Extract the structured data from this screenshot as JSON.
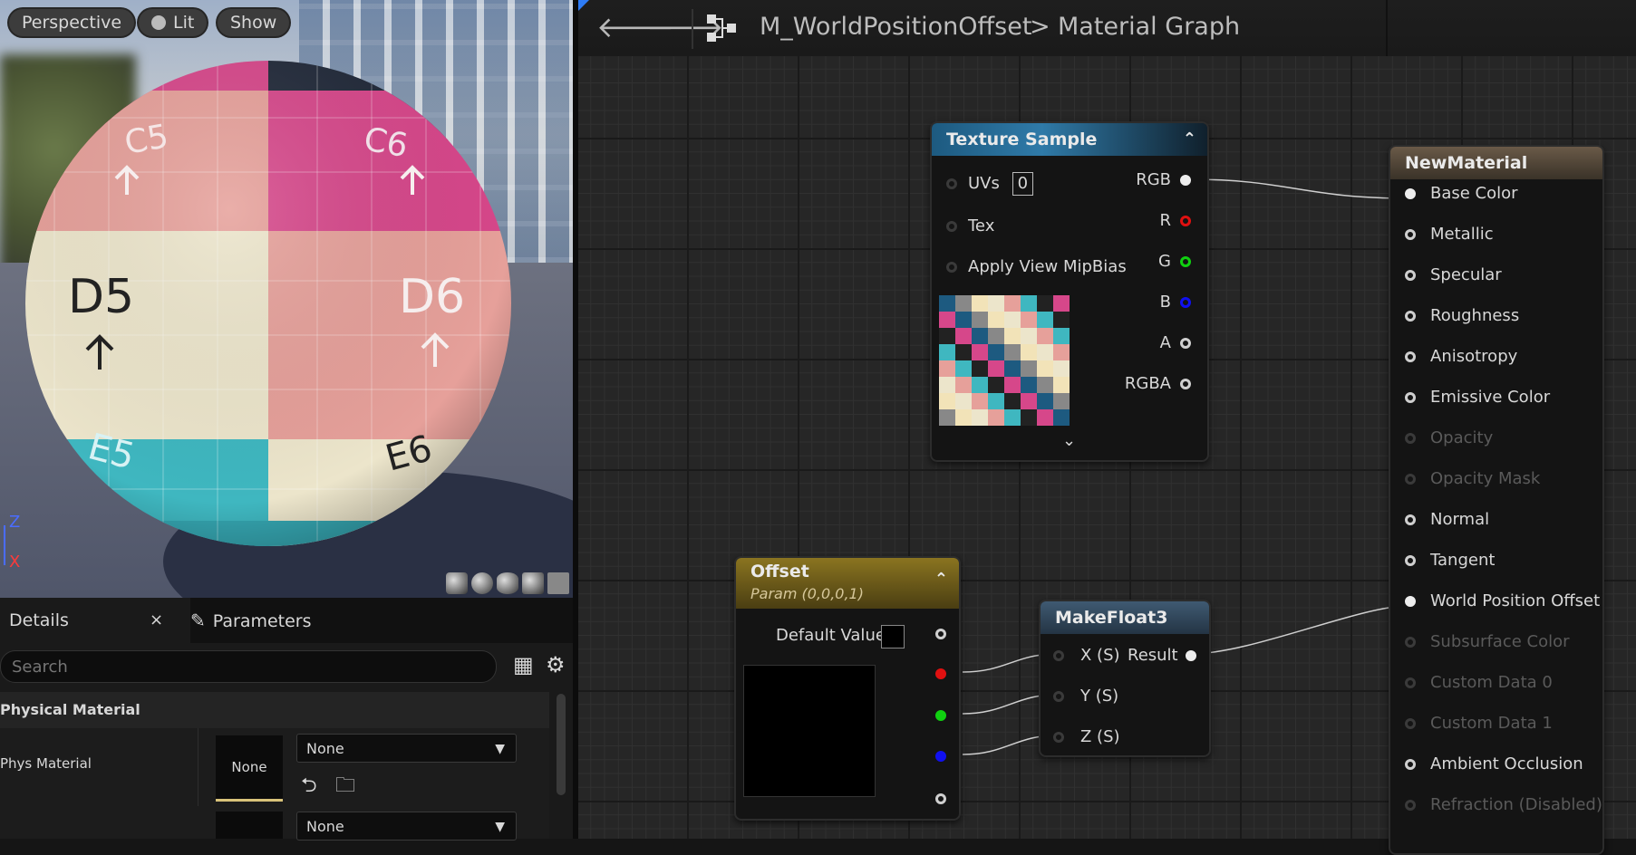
{
  "viewport": {
    "buttons": [
      "Perspective",
      "Lit",
      "Show"
    ],
    "sphere_labels": [
      "C5",
      "C6",
      "D5",
      "D6",
      "E5",
      "E6"
    ],
    "axis": {
      "z": "Z",
      "x": "X"
    }
  },
  "details": {
    "tab_details": "Details",
    "tab_params": "Parameters",
    "search_placeholder": "Search",
    "section": "Physical Material",
    "row1_label": "Phys Material",
    "thumb_text": "None",
    "combo1": "None",
    "combo2": "None"
  },
  "toolbar": {
    "asset": "M_WorldPositionOffset",
    "separator": ">",
    "graph": "Material Graph"
  },
  "texture_node": {
    "title": "Texture Sample",
    "inputs": [
      "UVs",
      "Tex",
      "Apply View MipBias"
    ],
    "uv_value": "0",
    "outputs": [
      "RGB",
      "R",
      "G",
      "B",
      "A",
      "RGBA"
    ]
  },
  "offset_node": {
    "title": "Offset",
    "subtitle": "Param (0,0,0,1)",
    "default_label": "Default Value"
  },
  "makefloat_node": {
    "title": "MakeFloat3",
    "inputs": [
      "X (S)",
      "Y (S)",
      "Z (S)"
    ],
    "output": "Result"
  },
  "material_node": {
    "title": "NewMaterial",
    "pins": [
      {
        "label": "Base Color",
        "enabled": true
      },
      {
        "label": "Metallic",
        "enabled": true
      },
      {
        "label": "Specular",
        "enabled": true
      },
      {
        "label": "Roughness",
        "enabled": true
      },
      {
        "label": "Anisotropy",
        "enabled": true
      },
      {
        "label": "Emissive Color",
        "enabled": true
      },
      {
        "label": "Opacity",
        "enabled": false
      },
      {
        "label": "Opacity Mask",
        "enabled": false
      },
      {
        "label": "Normal",
        "enabled": true
      },
      {
        "label": "Tangent",
        "enabled": true
      },
      {
        "label": "World Position Offset",
        "enabled": true
      },
      {
        "label": "Subsurface Color",
        "enabled": false
      },
      {
        "label": "Custom Data 0",
        "enabled": false
      },
      {
        "label": "Custom Data 1",
        "enabled": false
      },
      {
        "label": "Ambient Occlusion",
        "enabled": true
      },
      {
        "label": "Refraction (Disabled)",
        "enabled": false
      }
    ]
  },
  "colors": {
    "texture_head": "#1d5a80",
    "offset_head": "#8a7420",
    "makefloat_head": "#3f5a72",
    "material_head": "#6a5a48",
    "pin_red": "#e01010",
    "pin_green": "#10d010",
    "pin_blue": "#1010f0"
  }
}
